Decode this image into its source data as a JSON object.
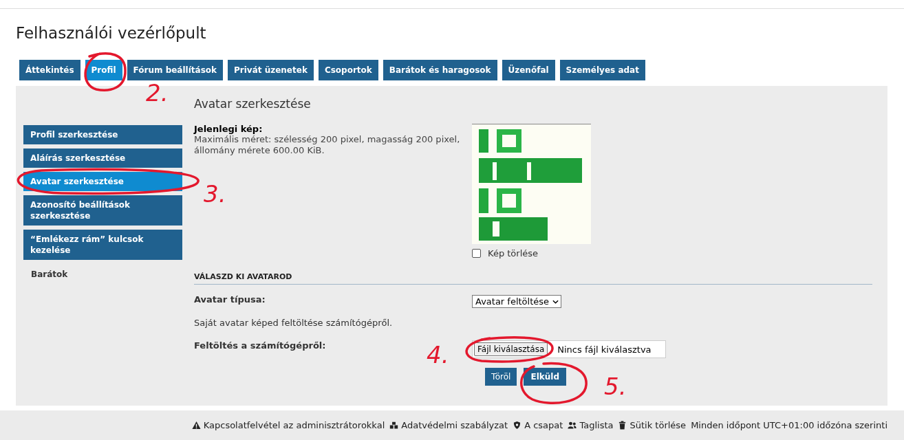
{
  "page_title": "Felhasználói vezérlőpult",
  "tabs": [
    {
      "label": "Áttekintés",
      "selected": false
    },
    {
      "label": "Profil",
      "selected": true
    },
    {
      "label": "Fórum beállítások",
      "selected": false
    },
    {
      "label": "Privát üzenetek",
      "selected": false
    },
    {
      "label": "Csoportok",
      "selected": false
    },
    {
      "label": "Barátok és haragosok",
      "selected": false
    },
    {
      "label": "Üzenőfal",
      "selected": false
    },
    {
      "label": "Személyes adat",
      "selected": false
    }
  ],
  "sidebar": {
    "items": [
      {
        "label": "Profil szerkesztése",
        "selected": false
      },
      {
        "label": "Aláírás szerkesztése",
        "selected": false
      },
      {
        "label": "Avatar szerkesztése",
        "selected": true
      },
      {
        "label": "Azonosító beállítások szerkesztése",
        "selected": false
      },
      {
        "label": "“Emlékezz rám” kulcsok kezelése",
        "selected": false
      }
    ],
    "section_heading": "Barátok"
  },
  "content": {
    "heading": "Avatar szerkesztése",
    "current_image": {
      "label": "Jelenlegi kép:",
      "hint": "Maximális méret: szélesség 200 pixel, magasság 200 pixel, állomány mérete 600.00 KiB.",
      "delete_checkbox": {
        "label": "Kép törlése",
        "checked": false
      }
    },
    "section_title": "VÁLASZD KI AVATAROD",
    "avatar_type": {
      "label": "Avatar típusa:",
      "value": "Avatar feltöltése"
    },
    "description": "Saját avatar képed feltöltése számítógépről.",
    "upload": {
      "label": "Feltöltés a számítógépről:",
      "button": "Fájl kiválasztása",
      "status": "Nincs fájl kiválasztva"
    },
    "buttons": [
      {
        "label": "Töröl",
        "kind": "reset"
      },
      {
        "label": "Elküld",
        "kind": "submit"
      }
    ]
  },
  "footer": {
    "links": [
      {
        "label": "Kapcsolatfelvétel az adminisztrátorokkal"
      },
      {
        "label": "Adatvédelmi szabályzat"
      },
      {
        "label": "A csapat"
      },
      {
        "label": "Taglista"
      },
      {
        "label": "Sütik törlése"
      }
    ],
    "timezone": "Minden időpont UTC+01:00 időzóna szerinti"
  },
  "annotations": [
    {
      "label": "2."
    },
    {
      "label": "3."
    },
    {
      "label": "4."
    },
    {
      "label": "5."
    }
  ]
}
